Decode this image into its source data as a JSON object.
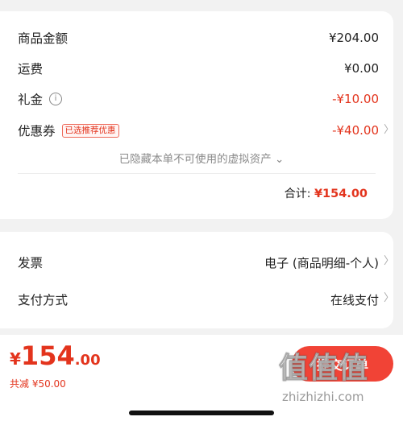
{
  "summary": {
    "rows": [
      {
        "label": "商品金额",
        "value": "¥204.00"
      },
      {
        "label": "运费",
        "value": "¥0.00"
      },
      {
        "label": "礼金",
        "value": "-¥10.00"
      },
      {
        "label": "优惠券",
        "value": "-¥40.00",
        "tag": "已选推荐优惠"
      }
    ],
    "hidden_note": "已隐藏本单不可使用的虚拟资产",
    "total_label": "合计:",
    "total_value": "¥154.00"
  },
  "settings": {
    "invoice_label": "发票",
    "invoice_value": "电子 (商品明细-个人)",
    "payment_label": "支付方式",
    "payment_value": "在线支付"
  },
  "bottom": {
    "yen": "¥",
    "price_int": "154",
    "price_dec": ".00",
    "saving": "共减 ¥50.00",
    "submit_label": "提交订单"
  },
  "watermark": {
    "logo": "值值值",
    "url": "zhizhizhi.com"
  },
  "colors": {
    "accent": "#e3341d",
    "button": "#f14336"
  },
  "icons": {
    "info": "info-circle-icon",
    "chevron": "chevron-right-icon",
    "expand": "chevron-down-icon"
  }
}
